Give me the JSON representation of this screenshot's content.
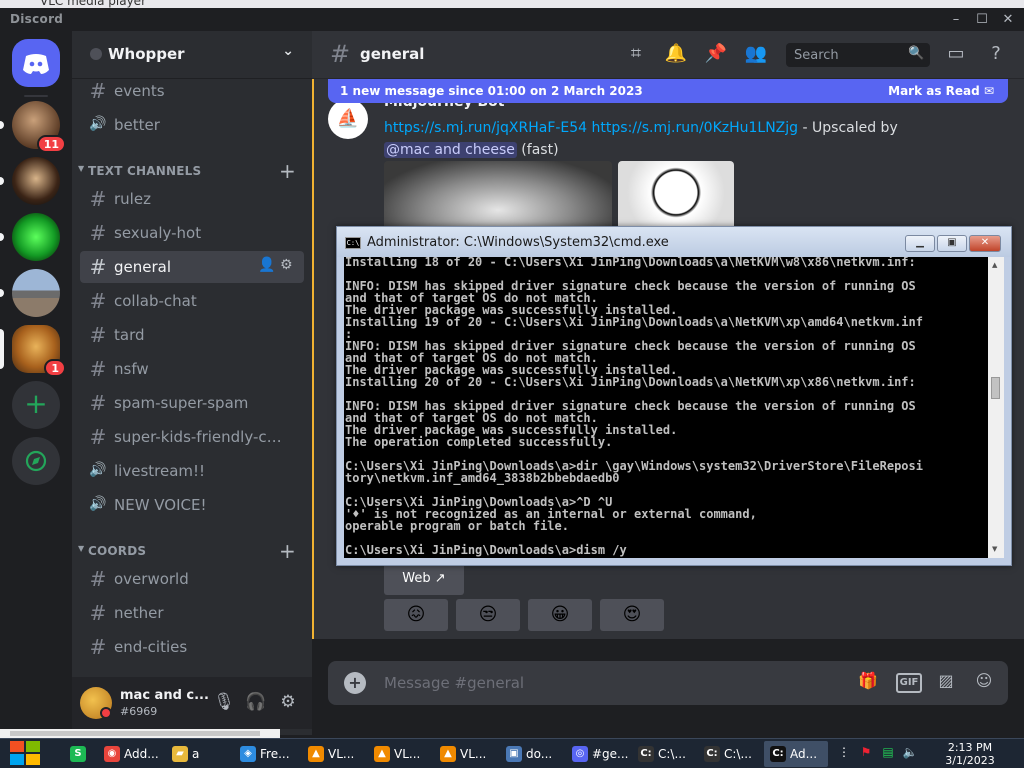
{
  "window": {
    "vlc_title": "VLC media player",
    "app_title": "Discord",
    "controls": [
      "–",
      "☐",
      "✕"
    ]
  },
  "servers": [
    {
      "name": "server-1",
      "badge": "11",
      "color": "#7a5b3a"
    },
    {
      "name": "server-2",
      "badge": "",
      "color": "#4a2f1e"
    },
    {
      "name": "server-3",
      "badge": "",
      "color": "#1b8f2a"
    },
    {
      "name": "server-4",
      "badge": "",
      "color": "#6d86a8"
    },
    {
      "name": "server-5",
      "badge": "1",
      "color": "#c98a2a"
    }
  ],
  "sidebar": {
    "server_name": "Whopper",
    "top_channels": [
      {
        "icon": "#",
        "label": "events"
      },
      {
        "icon": "🔊",
        "label": "better"
      }
    ],
    "category_text": "TEXT CHANNELS",
    "text_channels": [
      {
        "icon": "#",
        "label": "rulez"
      },
      {
        "icon": "#",
        "label": "sexualy-hot"
      },
      {
        "icon": "#",
        "label": "general",
        "active": true
      },
      {
        "icon": "#",
        "label": "collab-chat"
      },
      {
        "icon": "#",
        "label": "tard"
      },
      {
        "icon": "#",
        "label": "nsfw"
      },
      {
        "icon": "#",
        "label": "spam-super-spam"
      },
      {
        "icon": "#",
        "label": "super-kids-friendly-ch..."
      },
      {
        "icon": "🔊",
        "label": "livestream!!"
      },
      {
        "icon": "🔊",
        "label": "NEW VOICE!"
      }
    ],
    "category_coords": "COORDS",
    "coord_channels": [
      {
        "icon": "#",
        "label": "overworld"
      },
      {
        "icon": "#",
        "label": "nether"
      },
      {
        "icon": "#",
        "label": "end-cities"
      }
    ]
  },
  "user": {
    "name": "mac and c...",
    "tag": "#6969"
  },
  "header": {
    "channel": "general",
    "search_placeholder": "Search"
  },
  "chat": {
    "new_messages_text": "1 new message since 01:00 on 2 March 2023",
    "mark_as_read": "Mark as Read",
    "author": "Midjourney Bot",
    "link1": "https://s.mj.run/jqXRHaF-E54",
    "link2": "https://s.mj.run/0KzHu1LNZjg",
    "message_suffix": " - Upscaled by",
    "mention": "@mac and cheese",
    "message_tail": " (fast)",
    "web_button": "Web",
    "reactions": [
      "😖",
      "😒",
      "😀",
      "😍"
    ],
    "composer_placeholder": "Message #general"
  },
  "cmd": {
    "title": "Administrator: C:\\Windows\\System32\\cmd.exe",
    "lines": [
      "Installing 18 of 20 - C:\\Users\\Xi JinPing\\Downloads\\a\\NetKVM\\w8\\x86\\netkvm.inf:",
      "",
      "INFO: DISM has skipped driver signature check because the version of running OS",
      "and that of target OS do not match.",
      "The driver package was successfully installed.",
      "Installing 19 of 20 - C:\\Users\\Xi JinPing\\Downloads\\a\\NetKVM\\xp\\amd64\\netkvm.inf",
      ":",
      "INFO: DISM has skipped driver signature check because the version of running OS",
      "and that of target OS do not match.",
      "The driver package was successfully installed.",
      "Installing 20 of 20 - C:\\Users\\Xi JinPing\\Downloads\\a\\NetKVM\\xp\\x86\\netkvm.inf:",
      "",
      "INFO: DISM has skipped driver signature check because the version of running OS",
      "and that of target OS do not match.",
      "The driver package was successfully installed.",
      "The operation completed successfully.",
      "",
      "C:\\Users\\Xi JinPing\\Downloads\\a>dir \\gay\\Windows\\system32\\DriverStore\\FileReposi",
      "tory\\netkvm.inf_amd64_3838b2bbebdaedb0",
      "",
      "C:\\Users\\Xi JinPing\\Downloads\\a>^D ^U",
      "'♦' is not recognized as an internal or external command,",
      "operable program or batch file.",
      "",
      "C:\\Users\\Xi JinPing\\Downloads\\a>dism /y"
    ]
  },
  "taskbar": {
    "items": [
      {
        "label": "",
        "icon": "S",
        "color": "#1db954"
      },
      {
        "label": "Add...",
        "icon": "◉",
        "color": "#e8453c"
      },
      {
        "label": "a",
        "icon": "▰",
        "color": "#e8b93c"
      },
      {
        "label": "Fre...",
        "icon": "◈",
        "color": "#2d8ce0"
      },
      {
        "label": "VL...",
        "icon": "▲",
        "color": "#f08a00"
      },
      {
        "label": "VL...",
        "icon": "▲",
        "color": "#f08a00"
      },
      {
        "label": "VL...",
        "icon": "▲",
        "color": "#f08a00"
      },
      {
        "label": "do...",
        "icon": "▣",
        "color": "#4a78b5"
      },
      {
        "label": "#ge...",
        "icon": "◎",
        "color": "#5865f2"
      },
      {
        "label": "C:\\...",
        "icon": "C:",
        "color": "#333"
      },
      {
        "label": "C:\\...",
        "icon": "C:",
        "color": "#333"
      },
      {
        "label": "Ad...",
        "icon": "C:",
        "color": "#111",
        "active": true
      }
    ],
    "time": "2:13 PM",
    "date": "3/1/2023"
  },
  "colors": {
    "blurple": "#5865f2",
    "link": "#00a8fc",
    "danger": "#f23f43",
    "green": "#23a55a"
  }
}
